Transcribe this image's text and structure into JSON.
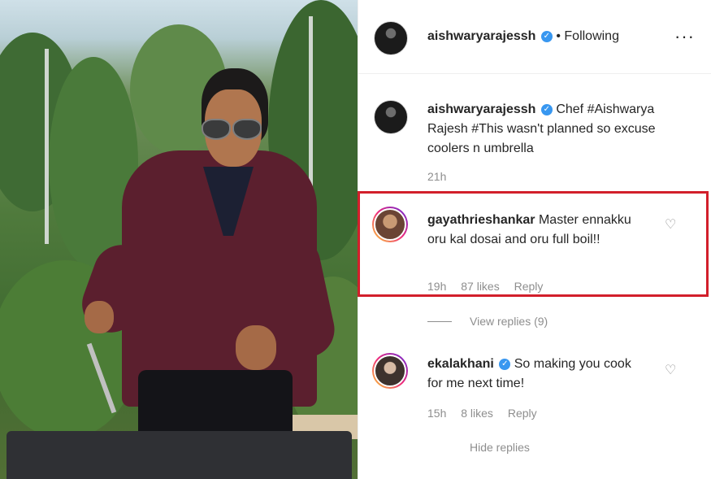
{
  "header": {
    "username": "aishwaryarajessh",
    "separator": "•",
    "follow_status": "Following",
    "more_icon": "···"
  },
  "caption": {
    "username": "aishwaryarajessh",
    "text": "Chef #Aishwarya Rajesh #This wasn't planned so excuse coolers n umbrella",
    "time": "21h"
  },
  "comments": [
    {
      "username": "gayathrieshankar",
      "text": "Master ennakku oru kal dosai and oru full boil!!",
      "time": "19h",
      "likes": "87 likes",
      "reply": "Reply"
    },
    {
      "username": "ekalakhani",
      "text": "So making you cook for me next time!",
      "time": "15h",
      "likes": "8 likes",
      "reply": "Reply"
    }
  ],
  "view_replies": "View replies (9)",
  "hide_replies": "Hide replies",
  "verified_mark": "✓",
  "heart_glyph": "♡",
  "colors": {
    "verified": "#3897f0",
    "highlight_border": "#d21f2b",
    "muted_text": "#8e8e8e"
  }
}
